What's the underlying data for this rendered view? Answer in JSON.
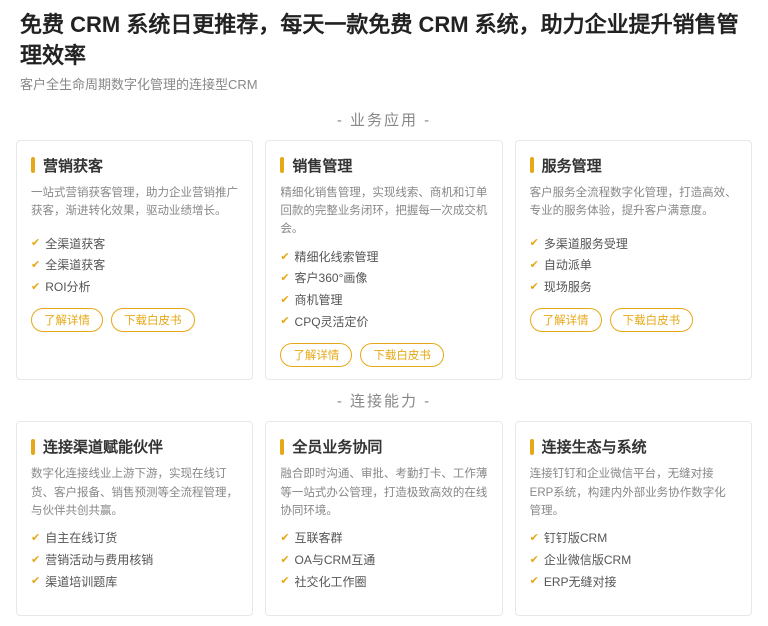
{
  "banner": {
    "main_title": "免费 CRM 系统日更推荐，每天一款免费 CRM 系统，助力企业提升销售管理效率",
    "sub_title": "客户全生命周期数字化管理的连接型CRM"
  },
  "sections": [
    {
      "label": "- 业务应用 -",
      "cards": [
        {
          "title": "营销获客",
          "desc": "一站式营销获客管理，助力企业营销推广获客，渐进转化效果，驱动业绩增长。",
          "list": [
            "全渠道获客",
            "全渠道获客",
            "ROI分析"
          ],
          "btn1": "了解详情",
          "btn2": "下载白皮书"
        },
        {
          "title": "销售管理",
          "desc": "精细化销售管理，实现线索、商机和订单回款的完整业务闭环，把握每一次成交机会。",
          "list": [
            "精细化线索管理",
            "客户360°画像",
            "商机管理",
            "CPQ灵活定价"
          ],
          "btn1": "了解详情",
          "btn2": "下载白皮书"
        },
        {
          "title": "服务管理",
          "desc": "客户服务全流程数字化管理，打造高效、专业的服务体验，提升客户满意度。",
          "list": [
            "多渠道服务受理",
            "自动派单",
            "现场服务"
          ],
          "btn1": "了解详情",
          "btn2": "下载白皮书"
        }
      ]
    },
    {
      "label": "- 连接能力 -",
      "cards": [
        {
          "title": "连接渠道赋能伙伴",
          "desc": "数字化连接线业上游下游，实现在线订货、客户报备、销售预测等全流程管理，与伙伴共创共赢。",
          "list": [
            "自主在线订货",
            "营销活动与费用核销",
            "渠道培训题库"
          ],
          "btn1": "",
          "btn2": ""
        },
        {
          "title": "全员业务协同",
          "desc": "融合即时沟通、审批、考勤打卡、工作薄等一站式办公管理，打造极致高效的在线协同环境。",
          "list": [
            "互联客群",
            "OA与CRM互通",
            "社交化工作圈"
          ],
          "btn1": "",
          "btn2": ""
        },
        {
          "title": "连接生态与系统",
          "desc": "连接钉钉和企业微信平台，无缝对接ERP系统，构建内外部业务协作数字化管理。",
          "list": [
            "钉钉版CRM",
            "企业微信版CRM",
            "ERP无缝对接"
          ],
          "btn1": "",
          "btn2": ""
        }
      ]
    }
  ]
}
